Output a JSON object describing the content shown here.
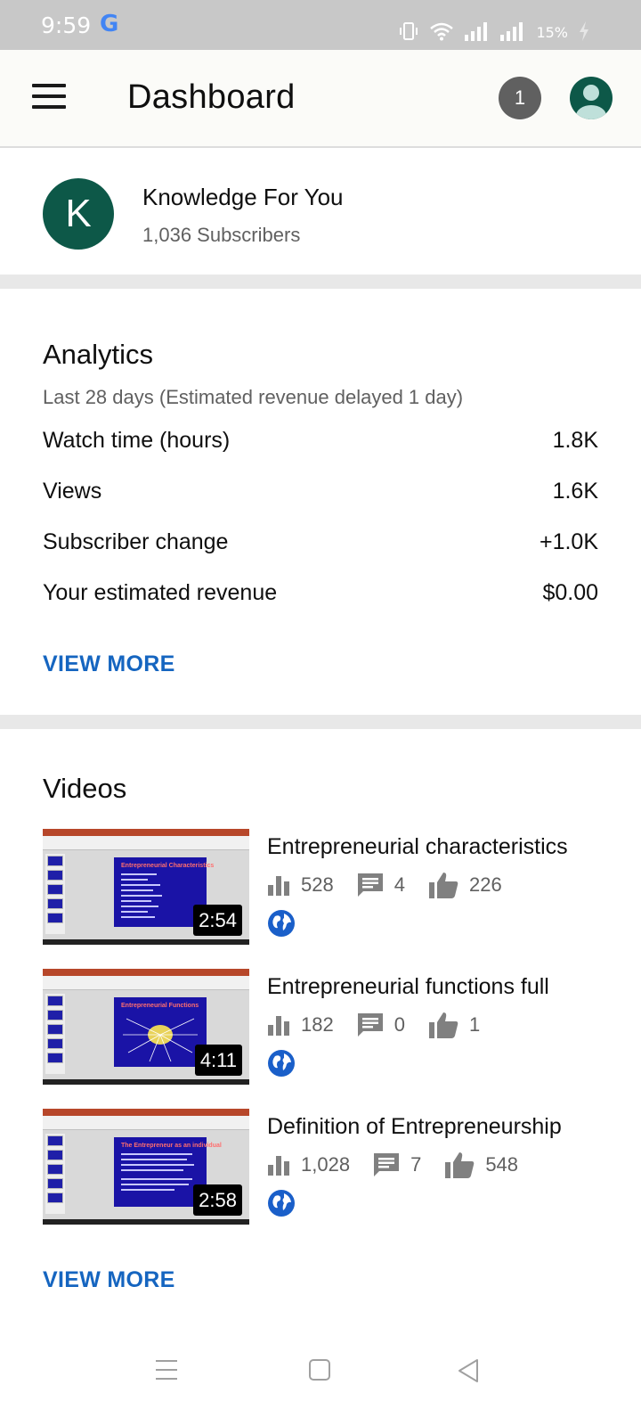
{
  "status_bar": {
    "time": "9:59",
    "google_icon": "G",
    "battery": "15%"
  },
  "header": {
    "title": "Dashboard",
    "notification_count": "1"
  },
  "channel": {
    "avatar_letter": "K",
    "name": "Knowledge For You",
    "subscribers": "1,036 Subscribers"
  },
  "analytics": {
    "title": "Analytics",
    "subtitle": "Last 28 days (Estimated revenue delayed 1 day)",
    "metrics": [
      {
        "label": "Watch time (hours)",
        "value": "1.8K"
      },
      {
        "label": "Views",
        "value": "1.6K"
      },
      {
        "label": "Subscriber change",
        "value": "+1.0K"
      },
      {
        "label": "Your estimated revenue",
        "value": "$0.00"
      }
    ],
    "view_more": "VIEW MORE"
  },
  "videos": {
    "title": "Videos",
    "items": [
      {
        "title": "Entrepreneurial characteristics",
        "duration": "2:54",
        "views": "528",
        "comments": "4",
        "likes": "226",
        "slide_heading": "Entrepreneurial Characteristics"
      },
      {
        "title": "Entrepreneurial functions full",
        "duration": "4:11",
        "views": "182",
        "comments": "0",
        "likes": "1",
        "slide_heading": "Entrepreneurial Functions"
      },
      {
        "title": "Definition of Entrepreneurship",
        "duration": "2:58",
        "views": "1,028",
        "comments": "7",
        "likes": "548",
        "slide_heading": "The Entrepreneur as an individual"
      }
    ],
    "view_more": "VIEW MORE"
  },
  "icons": {
    "menu": "menu-icon",
    "views": "bar-chart-icon",
    "comments": "comment-icon",
    "likes": "thumbs-up-icon",
    "visibility": "public-globe-icon"
  },
  "colors": {
    "accent": "#1565c0",
    "channel_avatar": "#0d5848",
    "text_primary": "#0f0f0f",
    "text_secondary": "#606060"
  }
}
